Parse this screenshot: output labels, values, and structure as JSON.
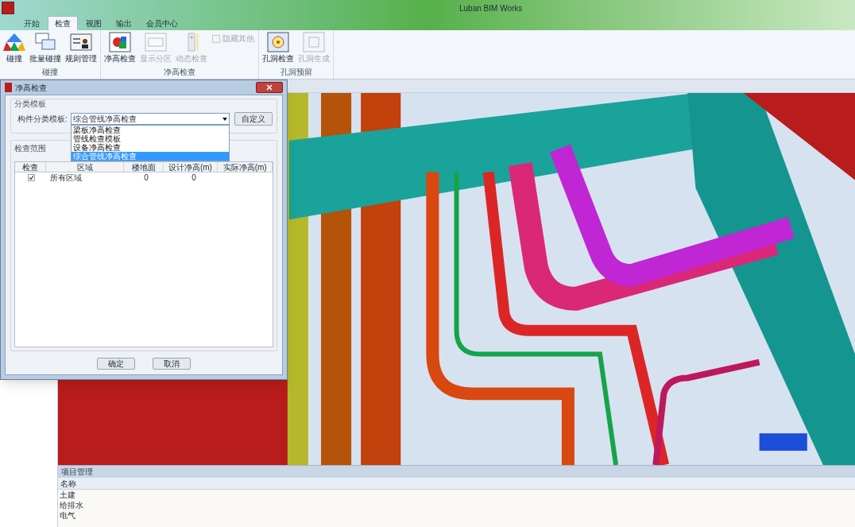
{
  "window": {
    "title": "Luban BIM Works"
  },
  "ribbon_tabs": [
    {
      "label": "开始",
      "selected": false
    },
    {
      "label": "检查",
      "selected": true
    },
    {
      "label": "视图",
      "selected": false
    },
    {
      "label": "输出",
      "selected": false
    },
    {
      "label": "会员中心",
      "selected": false
    }
  ],
  "ribbon_groups": [
    {
      "label": "碰撞",
      "items": [
        {
          "kind": "button",
          "label": "碰撞",
          "disabled": false
        },
        {
          "kind": "button",
          "label": "批量碰撞",
          "disabled": false
        },
        {
          "kind": "button",
          "label": "规则管理",
          "disabled": false
        }
      ]
    },
    {
      "label": "净高检查",
      "items": [
        {
          "kind": "button",
          "label": "净高检查",
          "disabled": false
        },
        {
          "kind": "button",
          "label": "显示分区",
          "disabled": true
        },
        {
          "kind": "button",
          "label": "动态检查",
          "disabled": true
        },
        {
          "kind": "checkbox",
          "label": "隐藏其他",
          "checked": false,
          "disabled": true
        }
      ]
    },
    {
      "label": "孔洞预留",
      "items": [
        {
          "kind": "button",
          "label": "孔洞检查",
          "disabled": false
        },
        {
          "kind": "button",
          "label": "孔洞生成",
          "disabled": true
        }
      ]
    }
  ],
  "dialog": {
    "title": "净高检查",
    "template_group": {
      "title": "分类模板",
      "label": "构件分类模板:",
      "value": "综合管线净高检查",
      "button": "自定义",
      "options": [
        {
          "label": "梁板净高检查",
          "selected": false
        },
        {
          "label": "管线检查模板",
          "selected": false
        },
        {
          "label": "设备净高检查",
          "selected": false
        },
        {
          "label": "综合管线净高检查",
          "selected": true
        }
      ]
    },
    "range_group": {
      "title": "检查范围",
      "columns": [
        "检查",
        "区域",
        "楼地面",
        "设计净高(m)",
        "实际净高(m)"
      ],
      "rows": [
        {
          "cells": [
            {
              "kind": "checkbox",
              "checked": true
            },
            {
              "kind": "text",
              "text": "所有区域"
            },
            {
              "kind": "text",
              "text": "0"
            },
            {
              "kind": "text",
              "text": "0"
            }
          ]
        }
      ]
    },
    "buttons": [
      "确定",
      "取消"
    ]
  },
  "project_panel": {
    "title": "项目管理",
    "column": "名称",
    "rows": [
      "土建",
      "给排水",
      "电气"
    ]
  }
}
